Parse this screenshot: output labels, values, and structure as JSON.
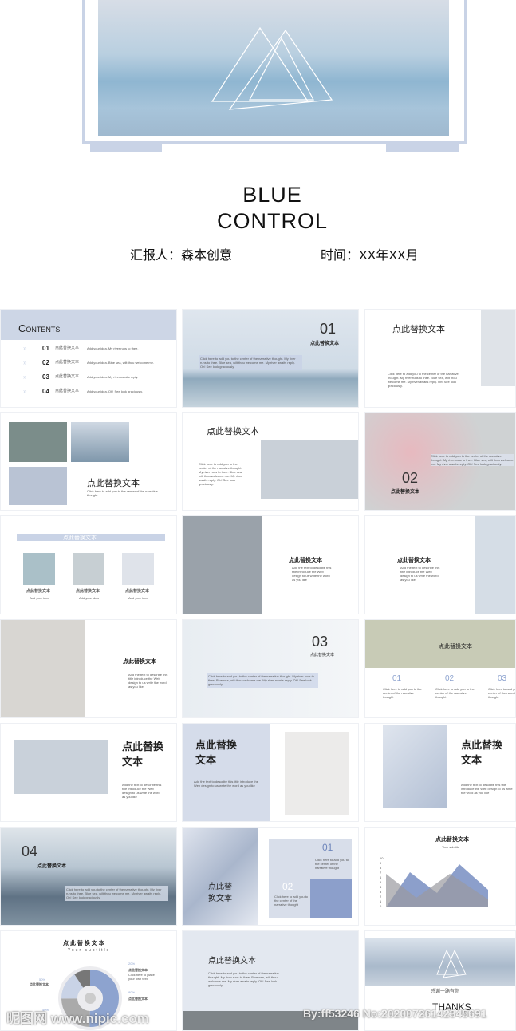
{
  "cover": {
    "title_line1": "BLUE",
    "title_line2": "CONTROL",
    "reporter": "汇报人：森本创意",
    "time": "时间：XX年XX月"
  },
  "contents": {
    "heading": "Contents",
    "items": [
      {
        "num": "01",
        "label": "点此替换文本",
        "desc": "Add your idea. My river runs to thee."
      },
      {
        "num": "02",
        "label": "点此替换文本",
        "desc": "Add your idea. Blue sea, wilt thou welcome me."
      },
      {
        "num": "03",
        "label": "点此替换文本",
        "desc": "Add your idea. My river awaits reply."
      },
      {
        "num": "04",
        "label": "点此替换文本",
        "desc": "Add your idea. Oh! See look graciously."
      }
    ]
  },
  "slides": {
    "s2": {
      "num": "01",
      "title": "点此替换文本",
      "body": "Click here to add you to the center of the narrative thought. My river runs to thee. Blue sea, wilt thou welcome me. My river awaits reply. Oh! See look graciously."
    },
    "s3": {
      "title": "点此替换文本",
      "body": "Click here to add you to the center of the narrative thought. My river runs to thee. Blue sea, wilt thou welcome me. My river awaits reply. Oh! See look graciously."
    },
    "s4": {
      "title": "点此替换文本",
      "body": "Click here to add you to the center of the narrative thought"
    },
    "s5": {
      "title": "点此替换文本",
      "body": "Click here to add you to the center of the narrative thought. My river runs to thee. Blue sea, wilt thou welcome me. My river awaits reply. Oh! See look graciously."
    },
    "s6": {
      "num": "02",
      "title": "点此替换文本",
      "body": "Click here to add you to the center of the narrative thought. My river runs to thee. Blue sea, wilt thou welcome me. My river awaits reply. Oh! See look graciously."
    },
    "s7": {
      "title": "点此替换文本",
      "items": [
        {
          "label": "点此替换文本",
          "desc": "Add your idea"
        },
        {
          "label": "点此替换文本",
          "desc": "Add your idea"
        },
        {
          "label": "点此替换文本",
          "desc": "Add your idea"
        }
      ]
    },
    "s8": {
      "title": "点此替换文本",
      "body": "Add the text to describe this title introduce the Web design to us write the word as you like"
    },
    "s9": {
      "title": "点此替换文本",
      "body": "Add the text to describe this title introduce the Web design to us write the word as you like"
    },
    "s10": {
      "title": "点此替换文本",
      "body": "Add the text to describe this title introduce the Web design to us write the word as you like"
    },
    "s11": {
      "num": "03",
      "title": "点此替换文本",
      "body": "Click here to add you to the center of the narrative thought. My river runs to thee. Blue sea, wilt thou welcome me. My river awaits reply. Oh! See look graciously."
    },
    "s12": {
      "title": "点此替换文本",
      "cols": [
        {
          "num": "01",
          "body": "Click here to add you to the center of the narrative thought"
        },
        {
          "num": "02",
          "body": "Click here to add you to the center of the narrative thought"
        },
        {
          "num": "03",
          "body": "Click here to add you to the center of the narrative thought"
        }
      ]
    },
    "s13": {
      "title": "点此替换\n文本",
      "body": "Add the text to describe this title introduce the Web design to us write the word as you like"
    },
    "s14": {
      "title": "点此替换\n文本",
      "body": "Add the text to describe this title introduce the Web design to us write the word as you like"
    },
    "s15": {
      "title": "点此替换\n文本",
      "body": "Add the text to describe this title introduce the Web design to us write the word as you like"
    },
    "s16": {
      "num": "04",
      "title": "点此替换文本",
      "body": "Click here to add you to the center of the narrative thought. My river runs to thee. Blue sea, wilt thou welcome me. My river awaits reply. Oh! See look graciously."
    },
    "s17": {
      "title": "点此替\n换文本",
      "n1": "01",
      "n2": "02",
      "b1": "Click here to add you to the center of the narrative thought",
      "b2": "Click here to add you to the center of the narrative thought"
    },
    "s18": {
      "title": "点此替换文本",
      "subtitle": "Your subtitle",
      "yticks": [
        "10",
        "9",
        "8",
        "7",
        "6",
        "5",
        "4",
        "3",
        "2",
        "1",
        "0"
      ]
    },
    "s19": {
      "title": "点 此 替 换 文 本",
      "subtitle": "Your subtitle",
      "p1": "20%",
      "p2": "50%",
      "p3": "80%",
      "p4": "40%",
      "label": "点此替换文本",
      "desc": "Click here to place your own text"
    },
    "s20": {
      "title": "点此替换文本",
      "body": "Click here to add you to the center of the narrative thought. My river runs to thee. Blue sea, wilt thou welcome me. My river awaits reply. Oh! See look graciously."
    },
    "s21": {
      "thanks_cn": "感谢一路有你",
      "thanks": "THANKS"
    }
  },
  "watermark": {
    "left": "昵图网 www.nipic.com",
    "right": "By:ff53246 No:20200726142345691"
  }
}
